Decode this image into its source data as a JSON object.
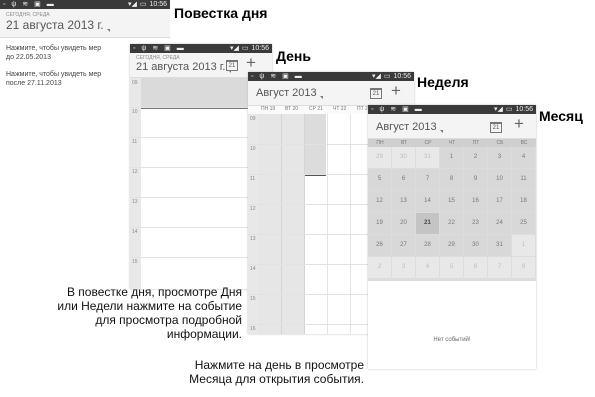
{
  "status": {
    "left_icons": "◦ ψ ≋ ▣ ▬",
    "time": "10:56",
    "signal_icon": "signal-wifi-icon",
    "battery_icon": "battery-icon"
  },
  "agenda": {
    "heading": "Повестка дня",
    "subdate": "СЕГОДНЯ, СРЕДА",
    "date": "21 августа 2013 г.",
    "items": [
      {
        "line1": "Нажмите, чтобы увидеть мер",
        "line2": "до 22.05.2013"
      },
      {
        "line1": "Нажмите, чтобы увидеть мер",
        "line2": "после 27.11.2013"
      }
    ]
  },
  "day": {
    "heading": "День",
    "subdate": "СЕГОДНЯ, СРЕДА",
    "date": "21 августа 2013 г.",
    "hours": [
      "09",
      "10",
      "11",
      "12",
      "13",
      "14",
      "15"
    ]
  },
  "week": {
    "heading": "Неделя",
    "month": "Август 2013",
    "days": [
      "ПН 19",
      "ВТ 20",
      "СР 21",
      "ЧТ 22",
      "ПТ 23"
    ],
    "hours": [
      "09",
      "10",
      "11",
      "12",
      "13",
      "14",
      "15",
      "16"
    ]
  },
  "month": {
    "heading": "Месяц",
    "title": "Август 2013",
    "weekdays": [
      "ПН",
      "ВТ",
      "СР",
      "ЧТ",
      "ПТ",
      "СБ",
      "ВС"
    ],
    "weeks": [
      [
        "29",
        "30",
        "31",
        "1",
        "2",
        "3",
        "4"
      ],
      [
        "5",
        "6",
        "7",
        "8",
        "9",
        "10",
        "11"
      ],
      [
        "12",
        "13",
        "14",
        "15",
        "16",
        "17",
        "18"
      ],
      [
        "19",
        "20",
        "21",
        "22",
        "23",
        "24",
        "25"
      ],
      [
        "26",
        "27",
        "28",
        "29",
        "30",
        "31",
        "1"
      ],
      [
        "2",
        "3",
        "4",
        "5",
        "6",
        "7",
        "8"
      ]
    ],
    "today": "21",
    "empty": "Нет событий!"
  },
  "calendar_icon_day": "21",
  "captions": {
    "left": [
      "В повестке дня, просмотре Дня",
      "или Недели нажмите на событие",
      "для просмотра подробной",
      "информации."
    ],
    "bottom": [
      "Нажмите на день в просмотре",
      "Месяца для открытия события."
    ]
  }
}
